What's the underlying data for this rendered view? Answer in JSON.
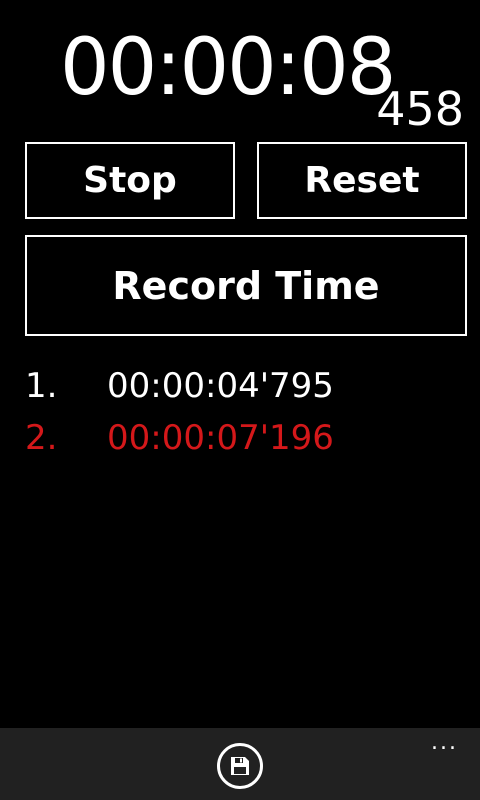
{
  "timer": {
    "main": "00:00:08",
    "ms": "458"
  },
  "buttons": {
    "stop_label": "Stop",
    "reset_label": "Reset",
    "record_label": "Record Time"
  },
  "laps": [
    {
      "index": "1.",
      "time": "00:00:04'795",
      "highlighted": false
    },
    {
      "index": "2.",
      "time": "00:00:07'196",
      "highlighted": true
    }
  ],
  "appbar": {
    "primary_icon": "save-icon",
    "more_label": "..."
  },
  "colors": {
    "background": "#000000",
    "foreground": "#ffffff",
    "accent": "#d4181a",
    "appbar": "#212121"
  }
}
